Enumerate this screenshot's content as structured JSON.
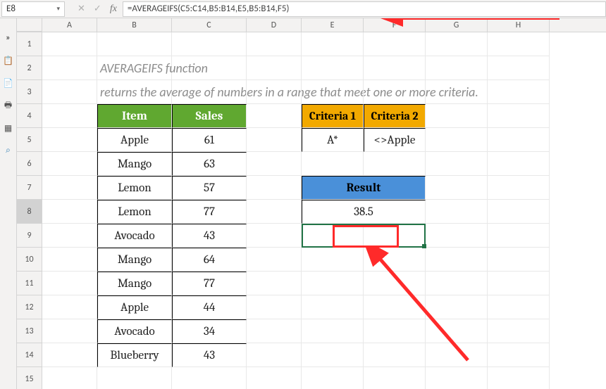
{
  "namebox": {
    "value": "E8"
  },
  "formula": "=AVERAGEIFS(C5:C14,B5:B14,E5,B5:B14,F5)",
  "columns": [
    "A",
    "B",
    "C",
    "D",
    "E",
    "F",
    "G",
    "H"
  ],
  "rownums": [
    "1",
    "2",
    "3",
    "4",
    "5",
    "6",
    "7",
    "8",
    "9",
    "10",
    "11",
    "12",
    "13",
    "14",
    "15"
  ],
  "titleLine1": "AVERAGEIFS function",
  "titleLine2": "returns the average of numbers in a range that meet one or more criteria.",
  "table": {
    "headers": {
      "item": "Item",
      "sales": "Sales"
    },
    "rows": [
      {
        "item": "Apple",
        "sales": "61"
      },
      {
        "item": "Mango",
        "sales": "63"
      },
      {
        "item": "Lemon",
        "sales": "57"
      },
      {
        "item": "Lemon",
        "sales": "77"
      },
      {
        "item": "Avocado",
        "sales": "43"
      },
      {
        "item": "Mango",
        "sales": "64"
      },
      {
        "item": "Mango",
        "sales": "77"
      },
      {
        "item": "Apple",
        "sales": "44"
      },
      {
        "item": "Avocado",
        "sales": "34"
      },
      {
        "item": "Blueberry",
        "sales": "43"
      }
    ]
  },
  "criteria": {
    "headers": {
      "c1": "Criteria 1",
      "c2": "Criteria 2"
    },
    "values": {
      "c1": "A*",
      "c2": "<>Apple"
    }
  },
  "result": {
    "header": "Result",
    "value": "38.5"
  },
  "chart_data": {
    "type": "table",
    "function": "AVERAGEIFS",
    "average_range": [
      61,
      63,
      57,
      77,
      43,
      64,
      77,
      44,
      34,
      43
    ],
    "criteria_range": [
      "Apple",
      "Mango",
      "Lemon",
      "Lemon",
      "Avocado",
      "Mango",
      "Mango",
      "Apple",
      "Avocado",
      "Blueberry"
    ],
    "criteria": [
      "A*",
      "<>Apple"
    ],
    "matching_values": [
      43,
      34
    ],
    "result": 38.5
  }
}
